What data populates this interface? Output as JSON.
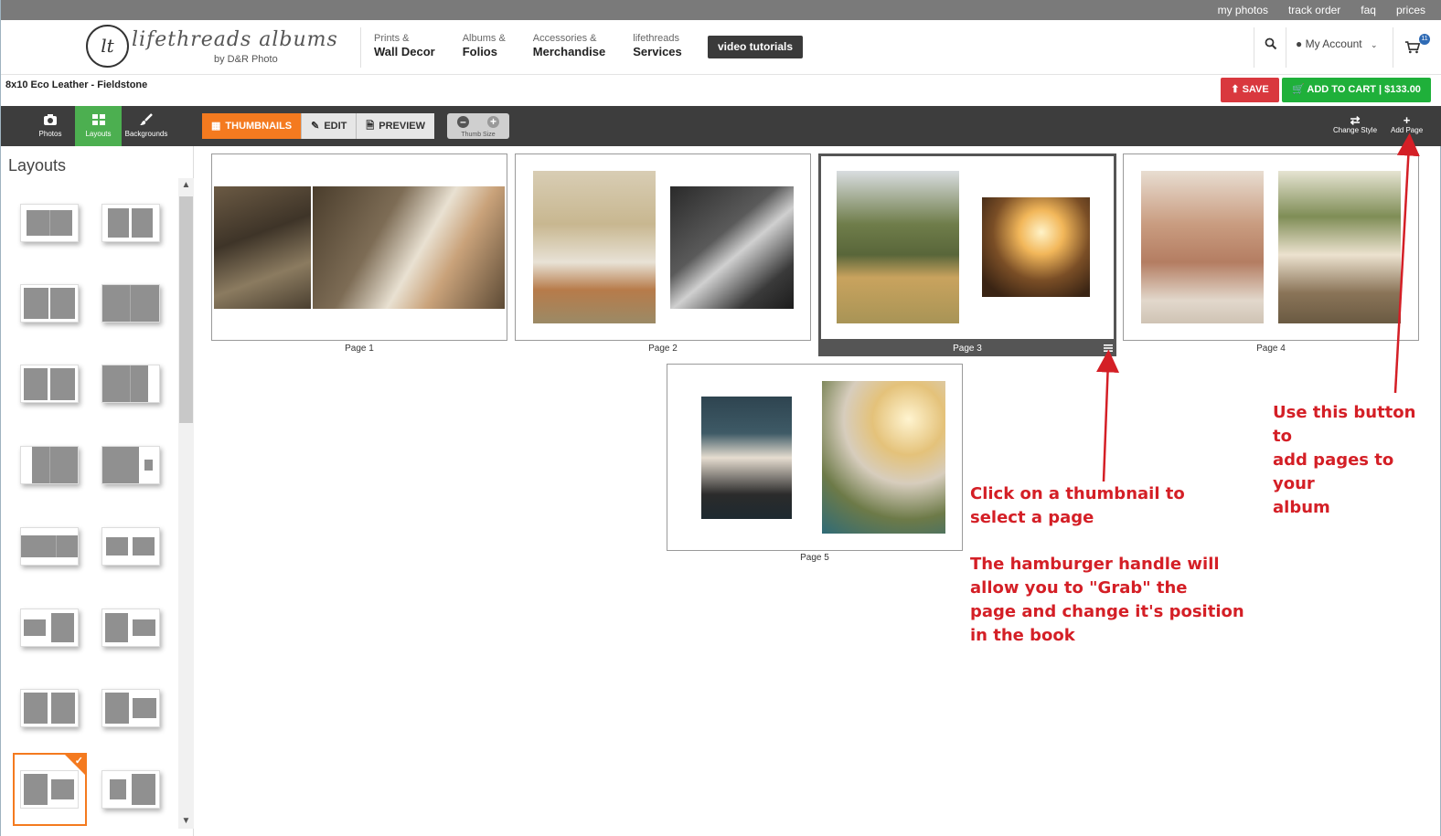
{
  "top_links": [
    "my photos",
    "track order",
    "faq",
    "prices"
  ],
  "logo": {
    "mark": "lt",
    "name": "lifethreads albums",
    "by": "by D&R Photo"
  },
  "nav": [
    {
      "small": "Prints &",
      "large": "Wall Decor"
    },
    {
      "small": "Albums &",
      "large": "Folios"
    },
    {
      "small": "Accessories &",
      "large": "Merchandise"
    },
    {
      "small": "lifethreads",
      "large": "Services"
    }
  ],
  "video_button": "video tutorials",
  "account_label": "My Account",
  "cart_count": "11",
  "product_title": "8x10 Eco Leather - Fieldstone",
  "save_label": "SAVE",
  "add_to_cart_label": "ADD TO CART | $133.00",
  "tool_tabs": {
    "photos": "Photos",
    "layouts": "Layouts",
    "backgrounds": "Backgrounds"
  },
  "modes": {
    "thumbnails": "THUMBNAILS",
    "edit": "EDIT",
    "preview": "PREVIEW"
  },
  "thumb_size_label": "Thumb Size",
  "right_tools": {
    "change_style": "Change Style",
    "add_page": "Add Page"
  },
  "sidebar_title": "Layouts",
  "pages": [
    {
      "label": "Page 1"
    },
    {
      "label": "Page 2"
    },
    {
      "label": "Page 3"
    },
    {
      "label": "Page 4"
    },
    {
      "label": "Page 5"
    }
  ],
  "annotations": {
    "select": "Click on a thumbnail to\nselect a page",
    "hamburger": "The hamburger handle will\nallow you to \"Grab\" the\npage and change it's position\nin the book",
    "add": "Use this button to\nadd pages to your\nalbum"
  },
  "colors": {
    "accent_orange": "#f47a1f",
    "save_red": "#d9383e",
    "cart_green": "#1fb03a",
    "annotation_red": "#d41f26",
    "layouts_green": "#4caf50"
  }
}
